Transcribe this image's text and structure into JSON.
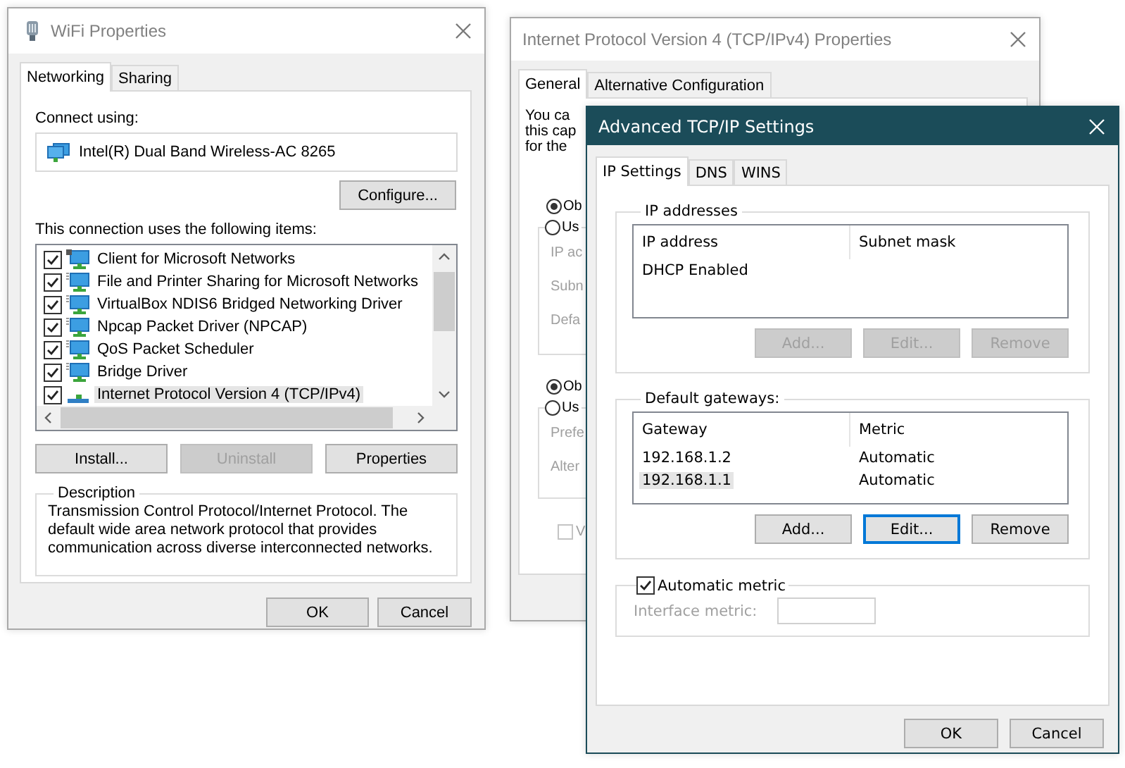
{
  "wifi_window": {
    "title": "WiFi Properties",
    "active": false,
    "tabs": [
      {
        "label": "Networking",
        "selected": true
      },
      {
        "label": "Sharing",
        "selected": false
      }
    ],
    "connect_using_label": "Connect using:",
    "adapter": "Intel(R) Dual Band Wireless-AC 8265",
    "configure_button": "Configure...",
    "items_label": "This connection uses the following items:",
    "items": [
      {
        "label": "Client for Microsoft Networks",
        "kind": "client",
        "checked": true,
        "selected": false
      },
      {
        "label": "File and Printer Sharing for Microsoft Networks",
        "kind": "service",
        "checked": true,
        "selected": false
      },
      {
        "label": "VirtualBox NDIS6 Bridged Networking Driver",
        "kind": "service",
        "checked": true,
        "selected": false
      },
      {
        "label": "Npcap Packet Driver (NPCAP)",
        "kind": "service",
        "checked": true,
        "selected": false
      },
      {
        "label": "QoS Packet Scheduler",
        "kind": "service",
        "checked": true,
        "selected": false
      },
      {
        "label": "Bridge Driver",
        "kind": "service",
        "checked": true,
        "selected": false
      },
      {
        "label": "Internet Protocol Version 4 (TCP/IPv4)",
        "kind": "protocol",
        "checked": true,
        "selected": true
      }
    ],
    "buttons": [
      {
        "label": "Install...",
        "disabled": false
      },
      {
        "label": "Uninstall",
        "disabled": true
      },
      {
        "label": "Properties",
        "disabled": false
      }
    ],
    "description": {
      "title": "Description",
      "text": "Transmission Control Protocol/Internet Protocol. The default wide area network protocol that provides communication across diverse interconnected networks."
    },
    "dialog_buttons": [
      "OK",
      "Cancel"
    ]
  },
  "ipv4_window": {
    "title": "Internet Protocol Version 4 (TCP/IPv4) Properties",
    "active": false,
    "tabs": [
      {
        "label": "General",
        "selected": true
      },
      {
        "label": "Alternative Configuration",
        "selected": false
      }
    ],
    "intro_lines": [
      "You ca",
      "this cap",
      "for the"
    ],
    "ip_radios": [
      {
        "label": "Ob",
        "selected": true
      },
      {
        "label": "Us",
        "selected": false
      }
    ],
    "ip_fields": [
      {
        "label": "IP ac",
        "disabled": true
      },
      {
        "label": "Subn",
        "disabled": true
      },
      {
        "label": "Defa",
        "disabled": true
      }
    ],
    "dns_radios": [
      {
        "label": "Ob",
        "selected": true
      },
      {
        "label": "Us",
        "selected": false
      }
    ],
    "dns_fields": [
      {
        "label": "Prefe",
        "disabled": true
      },
      {
        "label": "Alter",
        "disabled": true
      }
    ],
    "validate_checkbox": {
      "label": "V",
      "checked": false,
      "disabled": true
    }
  },
  "advanced_window": {
    "title": "Advanced TCP/IP Settings",
    "active": true,
    "tabs": [
      {
        "label": "IP Settings",
        "selected": true
      },
      {
        "label": "DNS",
        "selected": false
      },
      {
        "label": "WINS",
        "selected": false
      }
    ],
    "ip_addresses": {
      "title": "IP addresses",
      "columns": [
        "IP address",
        "Subnet mask"
      ],
      "rows": [
        {
          "cells": [
            "DHCP Enabled"
          ],
          "selected": false
        }
      ],
      "buttons": [
        {
          "label": "Add...",
          "disabled": true,
          "focused": false
        },
        {
          "label": "Edit...",
          "disabled": true,
          "focused": false
        },
        {
          "label": "Remove",
          "disabled": true,
          "focused": false
        }
      ]
    },
    "gateways": {
      "title": "Default gateways:",
      "columns": [
        "Gateway",
        "Metric"
      ],
      "rows": [
        {
          "cells": [
            "192.168.1.2",
            "Automatic"
          ],
          "selected": false
        },
        {
          "cells": [
            "192.168.1.1",
            "Automatic"
          ],
          "selected": true
        }
      ],
      "buttons": [
        {
          "label": "Add...",
          "disabled": false,
          "focused": false
        },
        {
          "label": "Edit...",
          "disabled": false,
          "focused": true
        },
        {
          "label": "Remove",
          "disabled": false,
          "focused": false
        }
      ]
    },
    "automatic_metric": {
      "label": "Automatic metric",
      "checked": true
    },
    "interface_metric": {
      "label": "Interface metric:",
      "disabled": true
    },
    "dialog_buttons": [
      "OK",
      "Cancel"
    ]
  }
}
